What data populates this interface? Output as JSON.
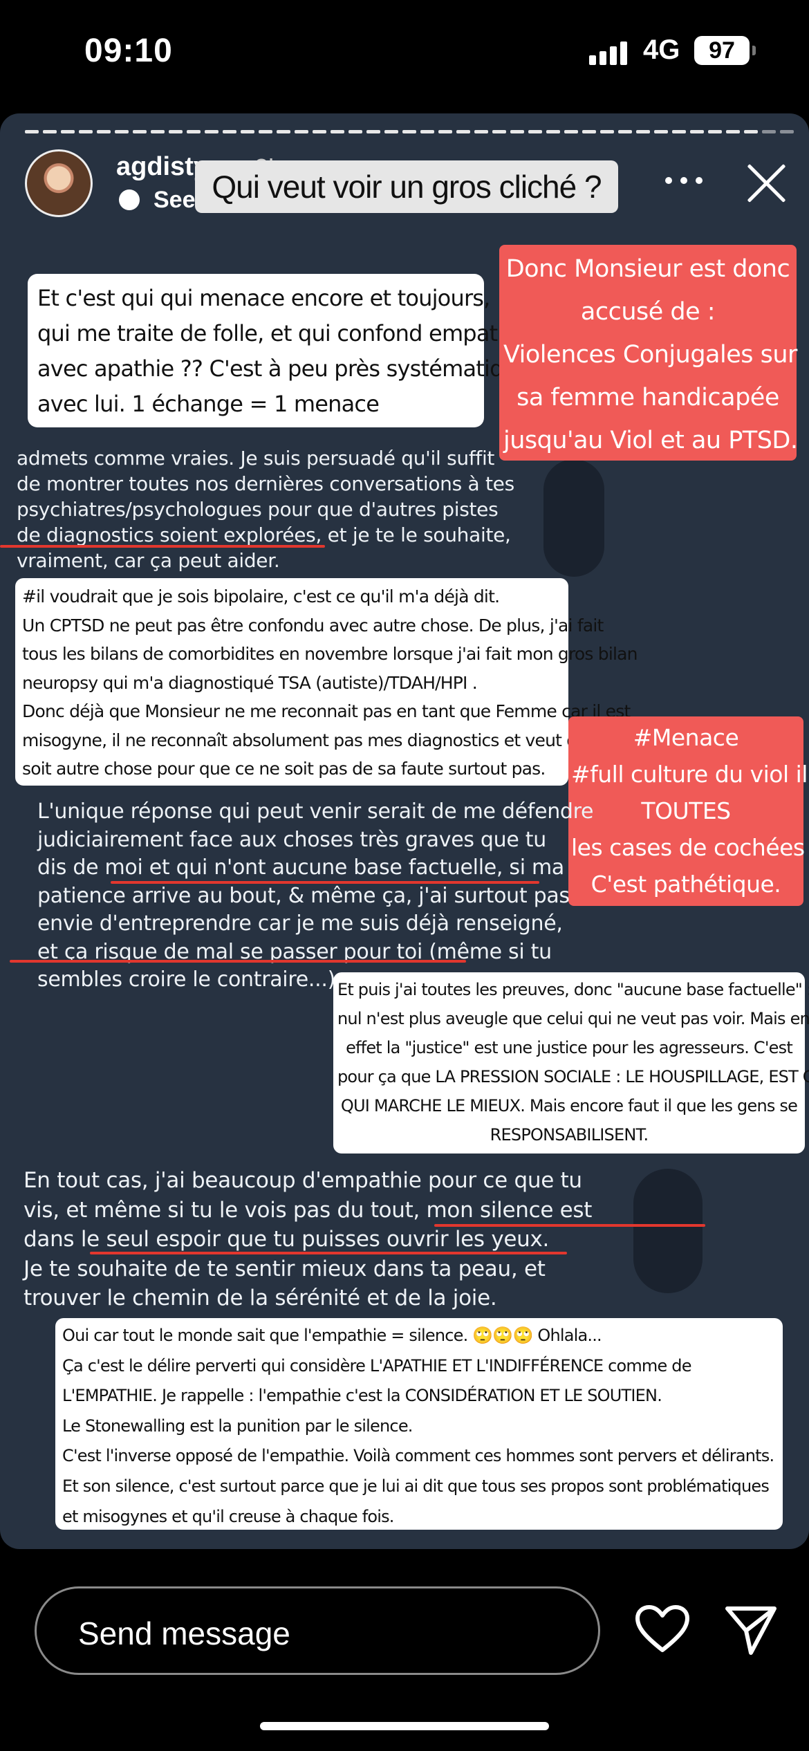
{
  "status_bar": {
    "time": "09:10",
    "network": "4G",
    "battery": "97"
  },
  "story_header": {
    "username": "agdistys",
    "time_ago": "2h",
    "see_translation": "See translation",
    "title_sticker": "Qui veut voir un gros cliché ?"
  },
  "overlays": {
    "box1": [
      "Et c'est qui qui menace encore et toujours,",
      "qui me traite de folle, et qui confond empathie",
      "avec apathie ?? C'est à peu près systématique",
      "avec lui.  1 échange = 1 menace"
    ],
    "red1": [
      "Donc Monsieur est donc",
      "accusé de :",
      "Violences Conjugales sur",
      "sa femme handicapée",
      "jusqu'au Viol et au PTSD."
    ],
    "box2": [
      "#il voudrait que je sois bipolaire, c'est ce qu'il m'a déjà dit.",
      "Un CPTSD ne peut pas être confondu avec autre chose. De plus, j'ai fait",
      "tous les bilans de comorbidites en novembre lorsque j'ai fait mon gros bilan",
      "neuropsy qui m'a diagnostiqué TSA (autiste)/TDAH/HPI .",
      "Donc déjà que Monsieur ne me reconnait pas en tant que Femme car il est",
      "misogyne, il ne reconnaît absolument pas mes diagnostics et veut que ce",
      "soit autre chose pour que ce ne soit pas de sa faute surtout pas."
    ],
    "red2": [
      "#Menace",
      "#full culture du viol il a",
      "TOUTES",
      "les cases de cochées",
      "C'est pathétique."
    ],
    "box3": [
      "Et puis j'ai toutes les preuves, donc \"aucune base factuelle\" :",
      "nul n'est plus aveugle que celui qui ne veut pas voir. Mais en",
      "effet la \"justice\" est une justice pour les agresseurs. C'est",
      "pour ça que LA PRESSION SOCIALE : LE HOUSPILLAGE, EST CE",
      "QUI MARCHE LE MIEUX. Mais encore faut il que les gens se",
      "RESPONSABILISENT."
    ],
    "box4": [
      "Oui car tout le monde sait que l'empathie = silence. 🙄🙄🙄 Ohlala...",
      "Ça c'est le délire perverti qui considère L'APATHIE ET L'INDIFFÉRENCE comme de",
      "L'EMPATHIE. Je rappelle : l'empathie c'est la CONSIDÉRATION ET LE SOUTIEN.",
      "Le Stonewalling est la punition par le silence.",
      "C'est l'inverse opposé de l'empathie. Voilà comment ces hommes sont pervers et délirants.",
      "Et son silence, c'est surtout parce que je lui ai dit que tous ses propos sont problématiques",
      "et misogynes et qu'il creuse à chaque fois."
    ]
  },
  "screenshot_text": {
    "block1": [
      "admets comme vraies. Je suis persuadé qu'il suffit",
      "de montrer toutes nos dernières conversations à tes",
      "psychiatres/psychologues pour que d'autres pistes",
      "de diagnostics soient explorées, et je te le souhaite,",
      "vraiment, car ça peut aider."
    ],
    "block2": [
      "L'unique réponse qui peut venir serait de me défendre",
      "judiciairement face aux choses très graves que tu",
      "dis de moi et qui n'ont aucune base factuelle, si ma",
      "patience arrive au bout, & même ça, j'ai surtout pas",
      "envie d'entreprendre car je me suis déjà renseigné,",
      "et ça risque de mal se passer pour toi (même si tu",
      "sembles croire le contraire...)"
    ],
    "block3": [
      "En tout cas, j'ai beaucoup d'empathie pour ce que tu",
      "vis, et même si tu le vois pas du tout, mon silence est",
      "dans le seul espoir que tu puisses ouvrir les yeux.",
      "Je te souhaite de te sentir mieux dans ta peau, et",
      "trouver le chemin de la sérénité et de la joie."
    ]
  },
  "bottom_bar": {
    "message_placeholder": "Send message"
  },
  "colors": {
    "story_bg": "#273241",
    "red_sticker": "#f05a57",
    "underline": "#e2372e"
  },
  "icons": [
    "signal-icon",
    "battery-icon",
    "more-icon",
    "close-icon",
    "heart-icon",
    "send-icon",
    "translate-icon"
  ]
}
